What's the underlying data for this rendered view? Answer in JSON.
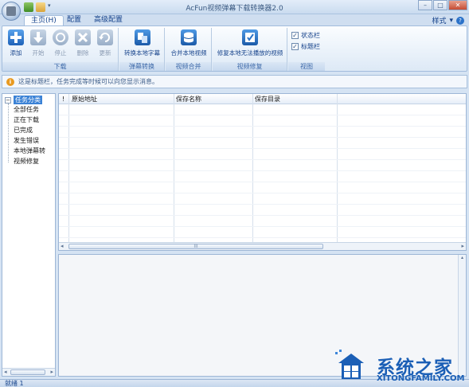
{
  "window": {
    "title": "AcFun视频弹幕下载转换器2.0",
    "controls": [
      "–",
      "□",
      "✕"
    ]
  },
  "tabs": [
    {
      "label": "主页(H)",
      "active": true
    },
    {
      "label": "配置",
      "active": false
    },
    {
      "label": "高级配置",
      "active": false
    }
  ],
  "style_menu": {
    "label": "样式",
    "help": "?"
  },
  "ribbon": {
    "groups": [
      {
        "label": "下载"
      },
      {
        "label": "弹幕转换"
      },
      {
        "label": "视频合并"
      },
      {
        "label": "视频修复"
      },
      {
        "label": "视图"
      }
    ],
    "download_buttons": [
      {
        "label": "添加",
        "icon": "plus-icon",
        "enabled": true
      },
      {
        "label": "开始",
        "icon": "down-arrow-icon",
        "enabled": false
      },
      {
        "label": "停止",
        "icon": "stop-icon",
        "enabled": false
      },
      {
        "label": "删除",
        "icon": "delete-x-icon",
        "enabled": false
      },
      {
        "label": "更新",
        "icon": "refresh-icon",
        "enabled": false
      }
    ],
    "convert_button": {
      "label": "转换本地字幕",
      "icon": "convert-icon"
    },
    "merge_button": {
      "label": "合并本地视频",
      "icon": "database-icon"
    },
    "repair_button": {
      "label": "修复本地无法播放的视频",
      "icon": "repair-icon"
    },
    "view_options": [
      {
        "label": "状态栏",
        "checked": true
      },
      {
        "label": "标题栏",
        "checked": true
      }
    ],
    "colors": {
      "accent": "#2a73c8",
      "disabled": "#a8bad1"
    }
  },
  "infobar": {
    "text": "这是标题栏，任务完成等时候可以向您显示消息。"
  },
  "tree": {
    "root": "任务分类",
    "expander": "⊟",
    "items": [
      "全部任务",
      "正在下载",
      "已完成",
      "发生错误",
      "本地弹幕转",
      "视频修复"
    ]
  },
  "grid": {
    "columns": [
      "!",
      "原始地址",
      "保存名称",
      "保存目录"
    ],
    "row_count": 0
  },
  "scroll": {
    "center_mark": "III"
  },
  "status": {
    "text": "就绪 1"
  },
  "watermark": {
    "cn": "系统之家",
    "en": "XITONGFAMILY.COM"
  }
}
